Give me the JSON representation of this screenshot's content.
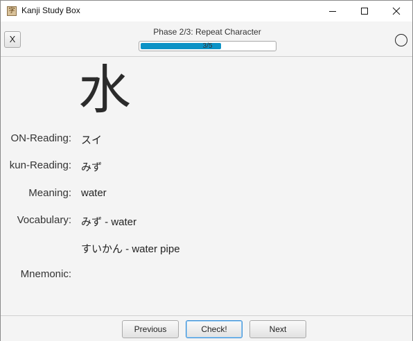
{
  "window": {
    "title": "Kanji Study Box",
    "app_icon_glyph": "字"
  },
  "toolbar": {
    "close_label": "X",
    "phase_label": "Phase 2/3: Repeat Character",
    "progress": {
      "text": "3/5",
      "fraction": 0.6,
      "color": "#0c93c6"
    }
  },
  "card": {
    "kanji": "水",
    "on_reading": {
      "label": "ON-Reading:",
      "value": "スイ"
    },
    "kun_reading": {
      "label": "kun-Reading:",
      "value": "みず"
    },
    "meaning": {
      "label": "Meaning:",
      "value": "water"
    },
    "vocabulary": {
      "label": "Vocabulary:",
      "items": [
        "みず - water",
        "すいかん - water pipe"
      ]
    },
    "mnemonic": {
      "label": "Mnemonic:",
      "value": ""
    }
  },
  "footer": {
    "previous": "Previous",
    "check": "Check!",
    "next": "Next"
  }
}
